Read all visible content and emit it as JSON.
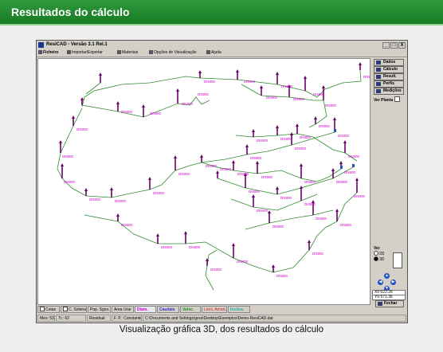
{
  "page": {
    "banner_title": "Resultados do cálculo",
    "caption": "Visualização gráfica 3D, dos resultados do cálculo"
  },
  "window": {
    "title": "ResiCAD - Versão 3.1 Rel.1",
    "controls": [
      "_",
      "□",
      "X"
    ]
  },
  "menu": {
    "items": [
      {
        "label": "Ficheiro",
        "icon": "folder-icon"
      },
      {
        "label": "Importar/Exportar",
        "icon": "import-icon"
      },
      {
        "label": "Materiais",
        "icon": "materials-icon"
      },
      {
        "label": "Opções de Visualização",
        "icon": "view-options-icon"
      },
      {
        "label": "Ajuda",
        "icon": "help-icon"
      }
    ]
  },
  "right_panel": {
    "buttons": [
      {
        "label": "Dados",
        "icon": "data-icon"
      },
      {
        "label": "Cálculo",
        "icon": "calc-icon"
      },
      {
        "label": "Result.",
        "icon": "results-icon"
      },
      {
        "label": "Perfis",
        "icon": "profiles-icon"
      },
      {
        "label": "Medições",
        "icon": "measure-icon"
      }
    ],
    "ver_planta": "Ver Planta",
    "ver_label": "Ver",
    "ver_options": [
      "2D",
      "3D"
    ],
    "ver_selected": "3D",
    "coord_x": "X0    622.26",
    "coord_y": "Y0    571.36",
    "fechar": "Fechar"
  },
  "bottom_tabs": [
    {
      "label": "Cotas",
      "checkbox": true,
      "color": "#000000"
    },
    {
      "label": "C. Soleira",
      "checkbox": true,
      "color": "#000000"
    },
    {
      "label": "Pop. Sgov.",
      "checkbox": false,
      "color": "#000000"
    },
    {
      "label": "Area Urar",
      "checkbox": false,
      "color": "#000000"
    },
    {
      "label": "Diam.",
      "checkbox": false,
      "color": "#cc00cc"
    },
    {
      "label": "Caudais",
      "checkbox": false,
      "color": "#3333cc"
    },
    {
      "label": "Veloc.",
      "checkbox": false,
      "color": "#228822"
    },
    {
      "label": "Lens. Amart.",
      "checkbox": false,
      "color": "#cc2222"
    },
    {
      "label": "Inclina.",
      "checkbox": false,
      "color": "#22aaaa"
    }
  ],
  "status_bar": {
    "mes": "Mes: 53",
    "troc": "Tr.: 62",
    "mode": "Residual",
    "fp": "F. P.: Constante",
    "path": "C:\\Documents and Settings\\gera\\Desktop\\Exemplos\\Demo-ResiCAD.dat"
  },
  "drawing": {
    "pipe_label": "DN800",
    "colors": {
      "pipe": "#2e8b2e",
      "label": "#cc00cc",
      "manhole": "#6a006a",
      "node_id": "#a5a500",
      "accent": "#1f55c8"
    }
  }
}
